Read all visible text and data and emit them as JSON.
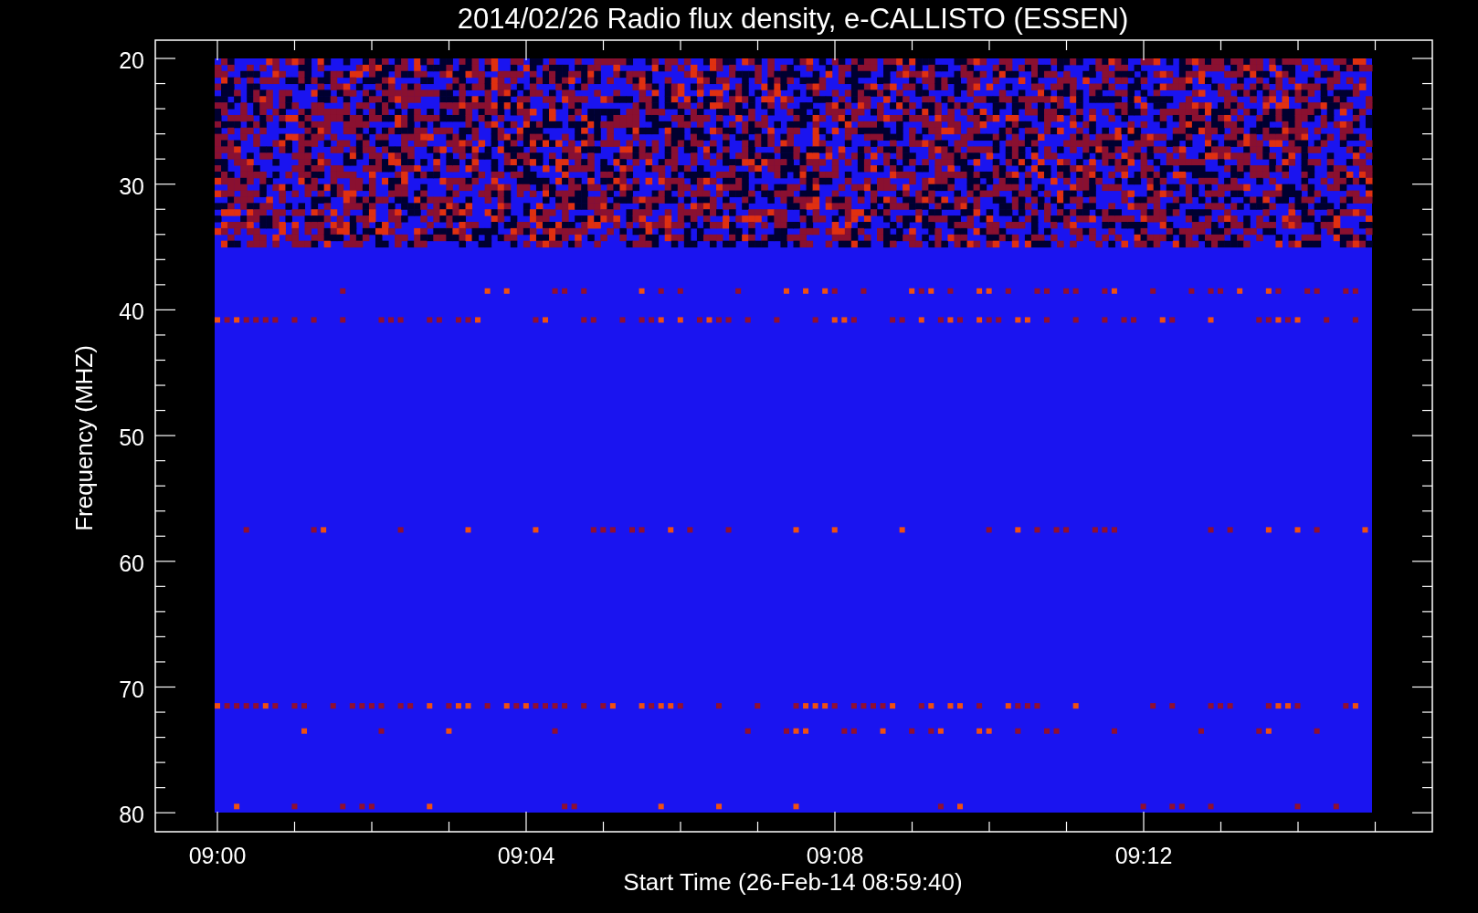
{
  "title": "2014/02/26  Radio flux density, e-CALLISTO (ESSEN)",
  "y_axis": {
    "label": "Frequency (MHZ)",
    "ticks": [
      "20",
      "30",
      "40",
      "50",
      "60",
      "70",
      "80"
    ]
  },
  "x_axis": {
    "label": "Start Time (26-Feb-14 08:59:40)",
    "ticks": [
      "09:00",
      "09:04",
      "09:08",
      "09:12"
    ]
  }
}
